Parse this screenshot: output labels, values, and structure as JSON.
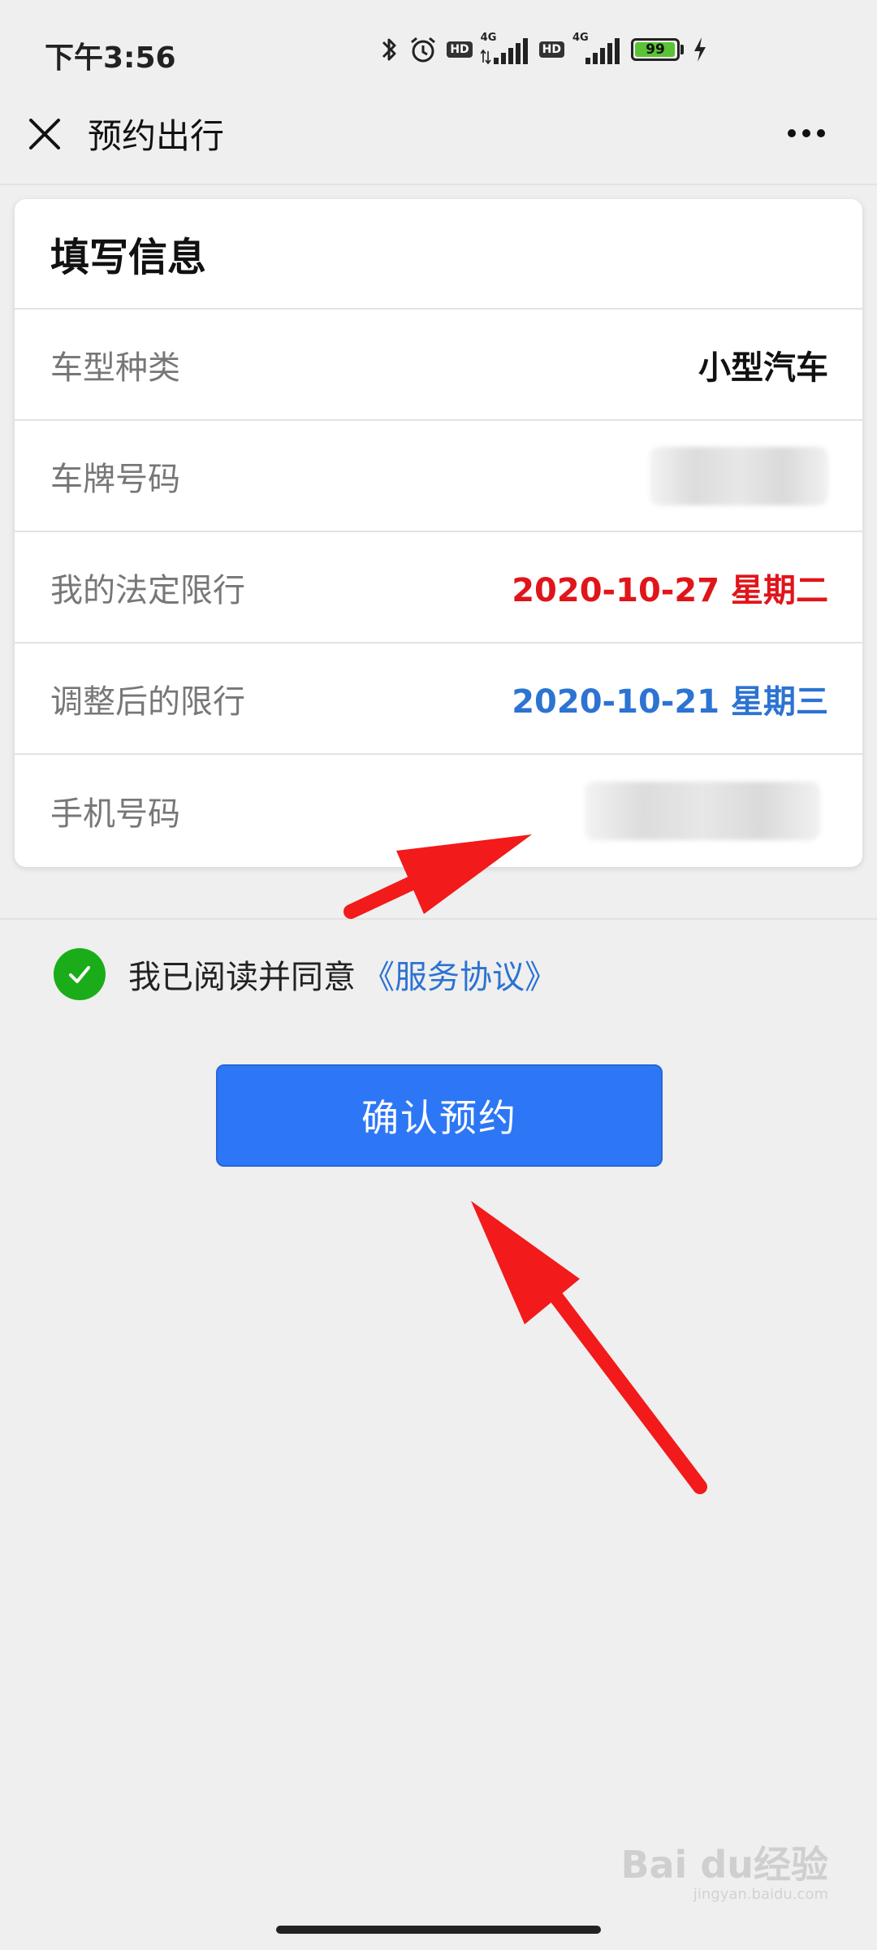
{
  "status_bar": {
    "time": "下午3:56",
    "hd_label": "HD",
    "network_label": "4G",
    "battery_level": "99",
    "battery_percent": 99
  },
  "nav": {
    "title": "预约出行"
  },
  "card": {
    "title": "填写信息",
    "rows": [
      {
        "label": "车型种类",
        "value": "小型汽车"
      },
      {
        "label": "车牌号码",
        "value": ""
      },
      {
        "label": "我的法定限行",
        "value": "2020-10-27 星期二"
      },
      {
        "label": "调整后的限行",
        "value": "2020-10-21 星期三"
      },
      {
        "label": "手机号码",
        "value": ""
      }
    ]
  },
  "agreement": {
    "text": "我已阅读并同意",
    "link": "《服务协议》",
    "checked": true
  },
  "confirm_button": "确认预约",
  "watermark": {
    "logo": "Bai du经验",
    "url": "jingyan.baidu.com"
  },
  "colors": {
    "accent_blue": "#2d77f6",
    "red_value": "#e0151a",
    "blue_value": "#2c73d2",
    "check_green": "#1aad19",
    "arrow_red": "#f21a1a"
  }
}
